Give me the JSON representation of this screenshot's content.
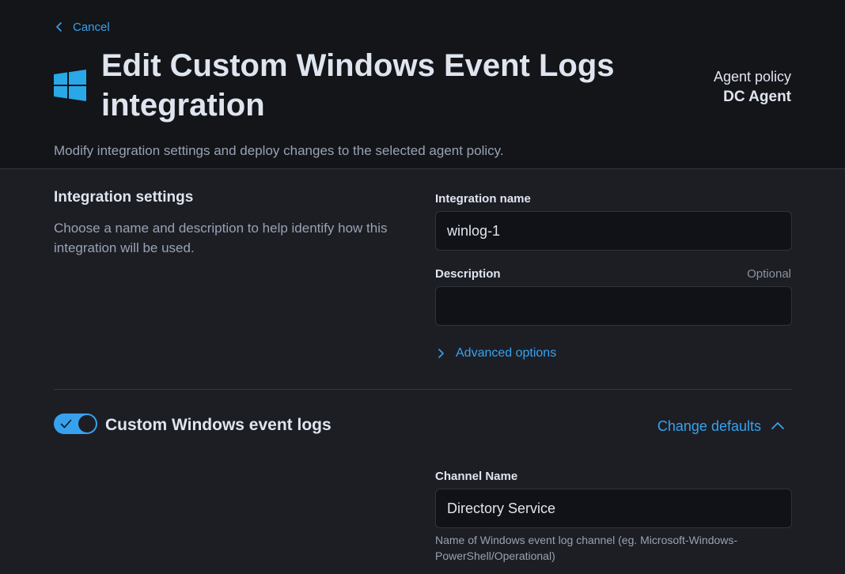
{
  "header": {
    "cancel_label": "Cancel",
    "title": "Edit Custom Windows Event Logs integration",
    "agent_policy_label": "Agent policy",
    "agent_policy_value": "DC Agent",
    "subtitle": "Modify integration settings and deploy changes to the selected agent policy."
  },
  "integration_settings": {
    "title": "Integration settings",
    "description": "Choose a name and description to help identify how this integration will be used.",
    "name_label": "Integration name",
    "name_value": "winlog-1",
    "description_label": "Description",
    "description_optional": "Optional",
    "description_value": "",
    "advanced_options_label": "Advanced options"
  },
  "stream": {
    "enabled": true,
    "title": "Custom Windows event logs",
    "change_defaults_label": "Change defaults",
    "channel_label": "Channel Name",
    "channel_value": "Directory Service",
    "channel_help": "Name of Windows event log channel (eg. Microsoft-Windows-PowerShell/Operational)"
  },
  "colors": {
    "accent": "#36a2ef",
    "header_bg": "#141519",
    "page_bg": "#1d1e24",
    "input_bg": "#111217",
    "windows_logo": "#29a8e8"
  },
  "icons": {
    "cancel": "chevron-left-icon",
    "logo": "windows-logo-icon",
    "advanced": "chevron-right-icon",
    "toggle": "check-icon",
    "change_defaults": "chevron-up-icon"
  }
}
